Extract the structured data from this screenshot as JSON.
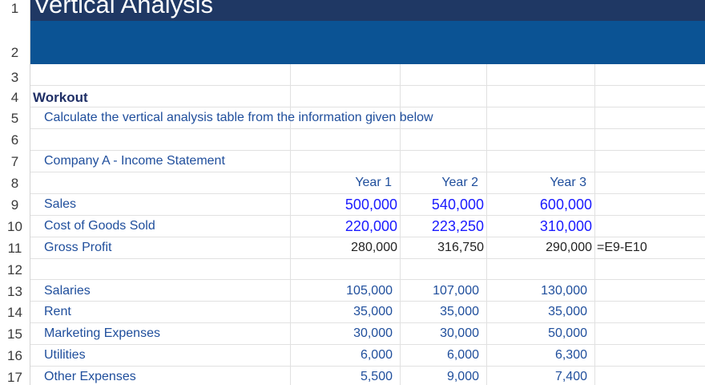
{
  "sheet": {
    "title": "Vertical Analysis",
    "row_numbers": [
      "1",
      "2",
      "3",
      "4",
      "5",
      "6",
      "7",
      "8",
      "9",
      "10",
      "11",
      "12",
      "13",
      "14",
      "15",
      "16",
      "17"
    ],
    "workout_label": "Workout",
    "instruction": "Calculate the vertical analysis table from the information given below",
    "statement_title": "Company A - Income Statement",
    "headers": [
      "Year 1",
      "Year 2",
      "Year 3"
    ],
    "rows": [
      {
        "label": "Sales",
        "values": [
          "500,000",
          "540,000",
          "600,000"
        ],
        "note": ""
      },
      {
        "label": "Cost of Goods Sold",
        "values": [
          "220,000",
          "223,250",
          "310,000"
        ],
        "note": ""
      },
      {
        "label": "Gross Profit",
        "values": [
          "280,000",
          "316,750",
          "290,000"
        ],
        "note": "=E9-E10"
      },
      {
        "label": "Salaries",
        "values": [
          "105,000",
          "107,000",
          "130,000"
        ],
        "note": ""
      },
      {
        "label": "Rent",
        "values": [
          "35,000",
          "35,000",
          "35,000"
        ],
        "note": ""
      },
      {
        "label": "Marketing Expenses",
        "values": [
          "30,000",
          "30,000",
          "50,000"
        ],
        "note": ""
      },
      {
        "label": "Utilities",
        "values": [
          "6,000",
          "6,000",
          "6,300"
        ],
        "note": ""
      },
      {
        "label": "Other Expenses",
        "values": [
          "5,500",
          "9,000",
          "7,400"
        ],
        "note": ""
      }
    ]
  },
  "colors": {
    "title_band": "#1f3864",
    "sub_band": "#0b5394",
    "label_text": "#1f4e9c",
    "input_text": "#1a1aff"
  }
}
